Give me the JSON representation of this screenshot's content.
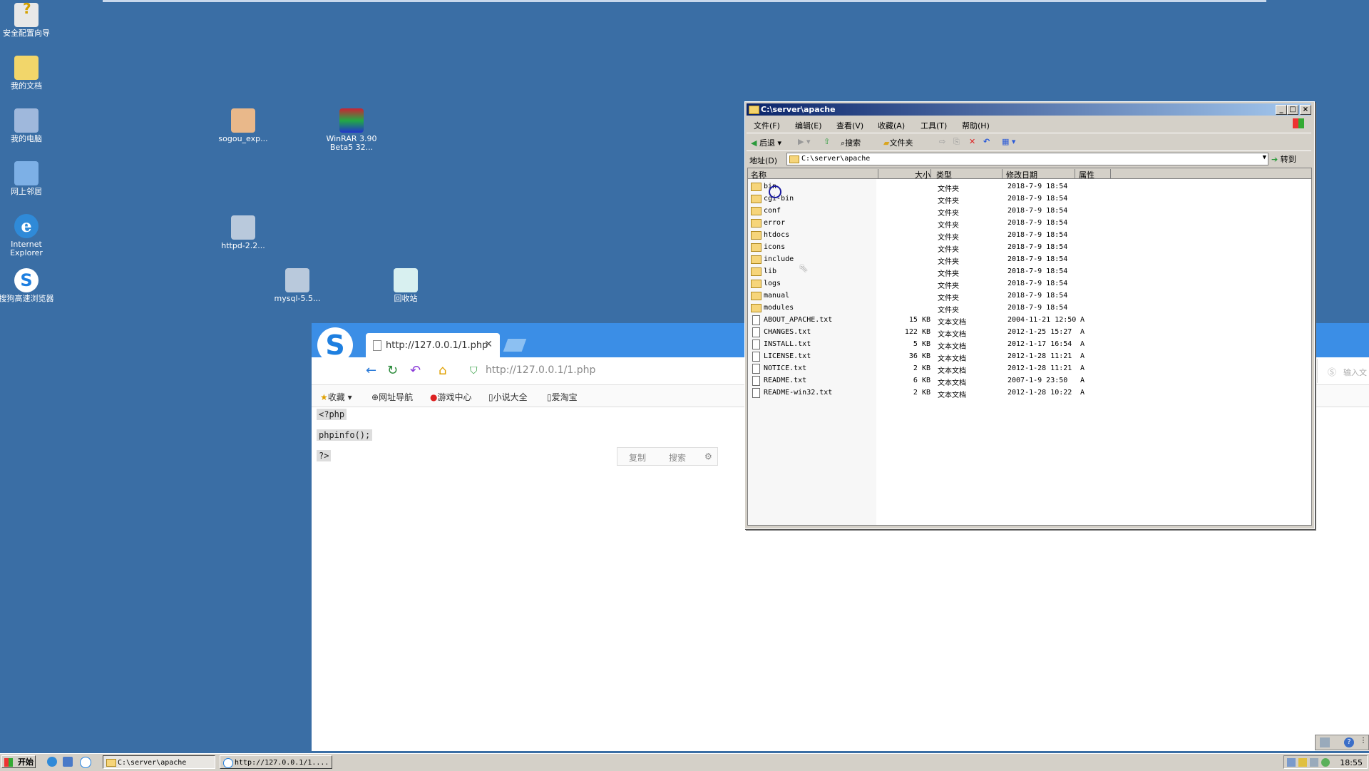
{
  "desktop": {
    "icons": [
      {
        "id": "security",
        "label": "安全配置向导"
      },
      {
        "id": "mydocs",
        "label": "我的文档"
      },
      {
        "id": "mycomputer",
        "label": "我的电脑"
      },
      {
        "id": "network",
        "label": "网上邻居"
      },
      {
        "id": "ie",
        "label": "Internet Explorer"
      },
      {
        "id": "sogou-browser",
        "label": "搜狗高速浏览器"
      },
      {
        "id": "sogou-exp",
        "label": "sogou_exp..."
      },
      {
        "id": "winrar",
        "label": "WinRAR 3.90 Beta5 32..."
      },
      {
        "id": "httpd",
        "label": "httpd-2.2..."
      },
      {
        "id": "mysql",
        "label": "mysql-5.5..."
      },
      {
        "id": "recycle",
        "label": "回收站"
      }
    ]
  },
  "browser": {
    "tab_title": "http://127.0.0.1/1.php",
    "url": "http://127.0.0.1/1.php",
    "search_placeholder": "输入文",
    "bookmarks": [
      "收藏",
      "网址导航",
      "游戏中心",
      "小说大全",
      "爱淘宝"
    ],
    "code_lines": [
      "<?php",
      "phpinfo();",
      "?>"
    ],
    "find_buttons": [
      "复制",
      "搜索"
    ]
  },
  "explorer": {
    "title": "C:\\server\\apache",
    "menus": [
      "文件(F)",
      "编辑(E)",
      "查看(V)",
      "收藏(A)",
      "工具(T)",
      "帮助(H)"
    ],
    "toolbar": {
      "back": "后退",
      "search": "搜索",
      "folders": "文件夹"
    },
    "address_label": "地址(D)",
    "address_value": "C:\\server\\apache",
    "go_label": "转到",
    "columns": [
      "名称",
      "大小",
      "类型",
      "修改日期",
      "属性"
    ],
    "rows": [
      {
        "name": "bin",
        "size": "",
        "type": "文件夹",
        "date": "2018-7-9 18:54",
        "attr": "",
        "kind": "folder"
      },
      {
        "name": "cgi-bin",
        "size": "",
        "type": "文件夹",
        "date": "2018-7-9 18:54",
        "attr": "",
        "kind": "folder"
      },
      {
        "name": "conf",
        "size": "",
        "type": "文件夹",
        "date": "2018-7-9 18:54",
        "attr": "",
        "kind": "folder"
      },
      {
        "name": "error",
        "size": "",
        "type": "文件夹",
        "date": "2018-7-9 18:54",
        "attr": "",
        "kind": "folder"
      },
      {
        "name": "htdocs",
        "size": "",
        "type": "文件夹",
        "date": "2018-7-9 18:54",
        "attr": "",
        "kind": "folder"
      },
      {
        "name": "icons",
        "size": "",
        "type": "文件夹",
        "date": "2018-7-9 18:54",
        "attr": "",
        "kind": "folder"
      },
      {
        "name": "include",
        "size": "",
        "type": "文件夹",
        "date": "2018-7-9 18:54",
        "attr": "",
        "kind": "folder"
      },
      {
        "name": "lib",
        "size": "",
        "type": "文件夹",
        "date": "2018-7-9 18:54",
        "attr": "",
        "kind": "folder"
      },
      {
        "name": "logs",
        "size": "",
        "type": "文件夹",
        "date": "2018-7-9 18:54",
        "attr": "",
        "kind": "folder"
      },
      {
        "name": "manual",
        "size": "",
        "type": "文件夹",
        "date": "2018-7-9 18:54",
        "attr": "",
        "kind": "folder"
      },
      {
        "name": "modules",
        "size": "",
        "type": "文件夹",
        "date": "2018-7-9 18:54",
        "attr": "",
        "kind": "folder"
      },
      {
        "name": "ABOUT_APACHE.txt",
        "size": "15 KB",
        "type": "文本文档",
        "date": "2004-11-21 12:50",
        "attr": "A",
        "kind": "txt"
      },
      {
        "name": "CHANGES.txt",
        "size": "122 KB",
        "type": "文本文档",
        "date": "2012-1-25 15:27",
        "attr": "A",
        "kind": "txt"
      },
      {
        "name": "INSTALL.txt",
        "size": "5 KB",
        "type": "文本文档",
        "date": "2012-1-17 16:54",
        "attr": "A",
        "kind": "txt"
      },
      {
        "name": "LICENSE.txt",
        "size": "36 KB",
        "type": "文本文档",
        "date": "2012-1-28 11:21",
        "attr": "A",
        "kind": "txt"
      },
      {
        "name": "NOTICE.txt",
        "size": "2 KB",
        "type": "文本文档",
        "date": "2012-1-28 11:21",
        "attr": "A",
        "kind": "txt"
      },
      {
        "name": "README.txt",
        "size": "6 KB",
        "type": "文本文档",
        "date": "2007-1-9 23:50",
        "attr": "A",
        "kind": "txt"
      },
      {
        "name": "README-win32.txt",
        "size": "2 KB",
        "type": "文本文档",
        "date": "2012-1-28 10:22",
        "attr": "A",
        "kind": "txt"
      }
    ]
  },
  "taskbar": {
    "start_label": "开始",
    "tasks": [
      "C:\\server\\apache",
      "http://127.0.0.1/1...."
    ],
    "clock": "18:55"
  }
}
